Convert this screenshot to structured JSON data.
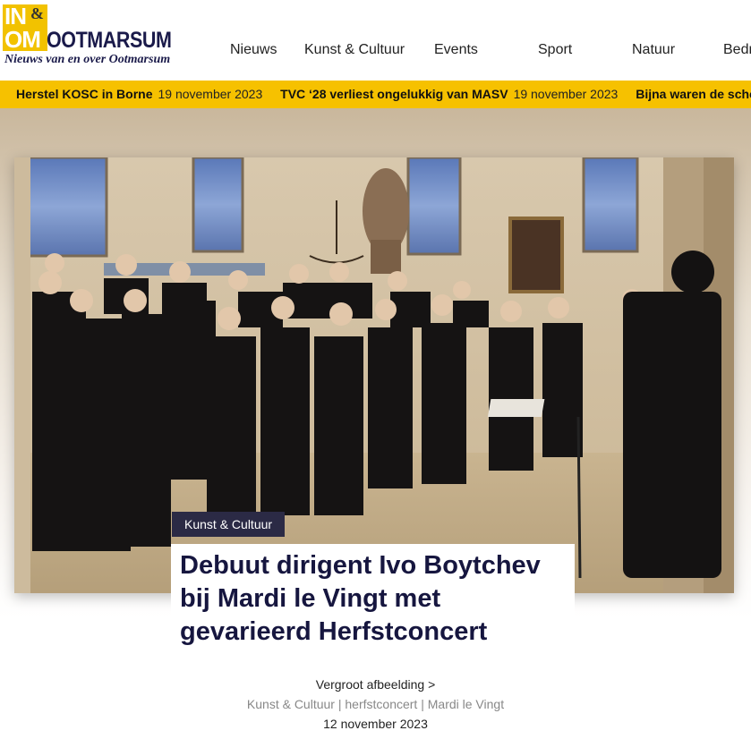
{
  "logo": {
    "in": "IN",
    "amp": "&",
    "om": "OM",
    "name": "OOTMARSUM",
    "tagline": "Nieuws van en over Ootmarsum"
  },
  "nav": {
    "items": [
      {
        "label": "Nieuws"
      },
      {
        "label": "Kunst & Cultuur"
      },
      {
        "label": "Events"
      },
      {
        "label": "Sport"
      },
      {
        "label": "Natuur"
      },
      {
        "label": "Bedr"
      }
    ]
  },
  "ticker": {
    "items": [
      {
        "title": "Herstel KOSC in Borne",
        "date": "19 november 2023"
      },
      {
        "title": "TVC ‘28 verliest ongelukkig van MASV",
        "date": "19 november 2023"
      },
      {
        "title": "Bijna waren de schoe",
        "date": ""
      }
    ]
  },
  "article": {
    "category": "Kunst & Cultuur",
    "title": "Debuut dirigent Ivo Boytchev bij Mardi le Vingt met gevarieerd Herfstconcert",
    "enlarge_link": "Vergroot afbeelding >",
    "tags": [
      "Kunst & Cultuur",
      "herfstconcert",
      "Mardi le Vingt"
    ],
    "tag_separator": " | ",
    "date": "12 november 2023"
  },
  "colors": {
    "brand_yellow": "#f6c100",
    "title_navy": "#16163f",
    "tag_bg": "#2b2a45"
  }
}
